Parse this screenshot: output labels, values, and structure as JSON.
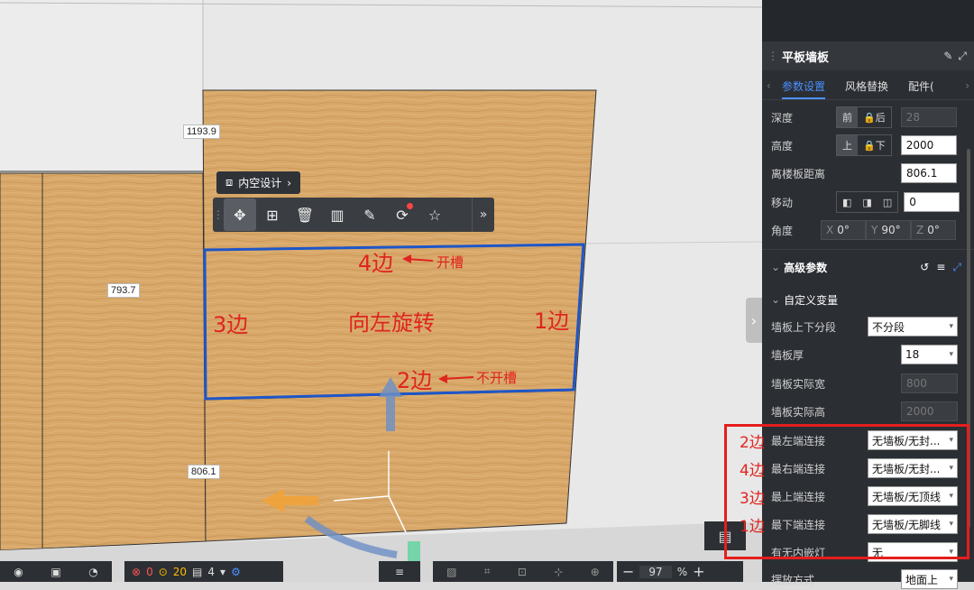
{
  "viewport": {
    "dims": {
      "top": "1193.9",
      "left": "793.7",
      "bottom": "806.1"
    },
    "design_pill": {
      "label": "内空设计"
    },
    "toolbar": {
      "icons": [
        "move-icon",
        "add-icon",
        "delete-icon",
        "split-icon",
        "brush-icon",
        "rotate-icon",
        "star-icon"
      ]
    },
    "annotations": {
      "edge4": "4边",
      "slot_on": "开槽",
      "edge3": "3边",
      "rotate": "向左旋转",
      "edge1": "1边",
      "edge2": "2边",
      "slot_off": "不开槽"
    },
    "bottom": {
      "errors": "0",
      "warnings": "20",
      "pages": "4",
      "zoom": "97",
      "percent": "%"
    }
  },
  "panel": {
    "title": "平板墙板",
    "tabs": [
      "参数设置",
      "风格替换",
      "配件("
    ],
    "depth": {
      "label": "深度",
      "front": "前",
      "back": "后",
      "value": "28"
    },
    "height": {
      "label": "高度",
      "up": "上",
      "down": "下",
      "value": "2000"
    },
    "floor_dist": {
      "label": "离楼板距离",
      "value": "806.1"
    },
    "move": {
      "label": "移动",
      "value": "0"
    },
    "angle": {
      "label": "角度",
      "x": "0°",
      "y": "90°",
      "z": "0°",
      "xl": "X",
      "yl": "Y",
      "zl": "Z"
    },
    "advanced": "高级参数",
    "custom": "自定义变量",
    "rows": [
      {
        "label": "墙板上下分段",
        "value": "不分段"
      },
      {
        "label": "墙板厚",
        "value": "18"
      },
      {
        "label": "墙板实际宽",
        "value": "800"
      },
      {
        "label": "墙板实际高",
        "value": "2000"
      },
      {
        "label": "最左端连接",
        "value": "无墙板/无封..."
      },
      {
        "label": "最右端连接",
        "value": "无墙板/无封..."
      },
      {
        "label": "最上端连接",
        "value": "无墙板/无顶线"
      },
      {
        "label": "最下端连接",
        "value": "无墙板/无脚线"
      },
      {
        "label": "有无内嵌灯",
        "value": "无"
      },
      {
        "label": "摆放方式",
        "value": "地面上"
      }
    ],
    "side_labels": [
      "2边",
      "4边",
      "3边",
      "1边"
    ]
  },
  "colors": {
    "accent": "#4a90ff",
    "annotation": "#e0241f",
    "wood": "#d9a96a"
  }
}
